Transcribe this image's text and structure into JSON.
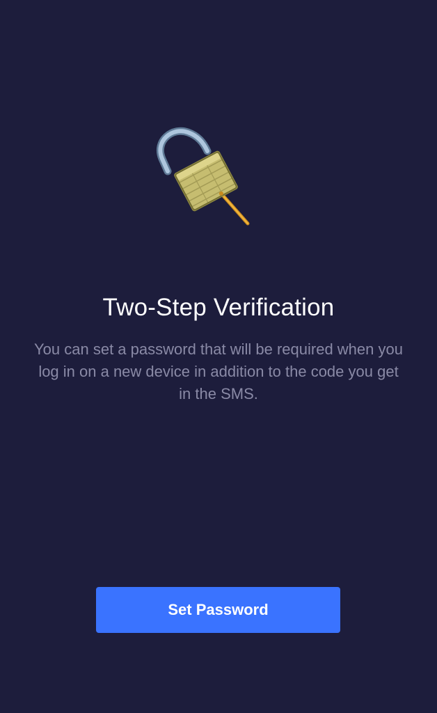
{
  "screen": {
    "title": "Two-Step Verification",
    "description": "You can set a password that will be required when you log in on a new device in addition to the code you get in the SMS.",
    "illustration_icon": "open-padlock-with-key-icon",
    "primary_button_label": "Set Password"
  },
  "colors": {
    "background": "#1d1d3c",
    "title": "#ffffff",
    "description": "#8a8aa6",
    "accent": "#3a73ff"
  }
}
